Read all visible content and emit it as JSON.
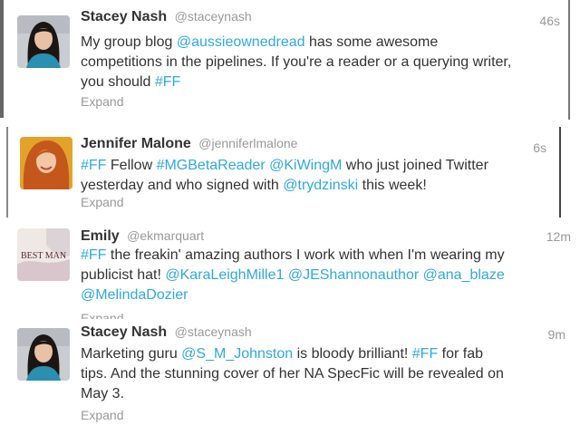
{
  "tweets": [
    {
      "name": "Stacey Nash",
      "handle": "@staceynash",
      "time": "46s",
      "avatar_icon": "woman-dark-hair-avatar-icon",
      "body": [
        [
          {
            "t": "My group blog "
          },
          {
            "t": "@aussieownedread",
            "link": true
          },
          {
            "t": " has some awesome"
          }
        ],
        [
          {
            "t": "competitions in the pipelines. If you're a reader or a querying writer,"
          }
        ],
        [
          {
            "t": "you should "
          },
          {
            "t": "#FF",
            "link": true
          }
        ]
      ],
      "expand": "Expand"
    },
    {
      "name": "Jennifer Malone",
      "handle": "@jenniferlmalone",
      "time": "6s",
      "avatar_icon": "woman-red-hair-avatar-icon",
      "body": [
        [
          {
            "t": "#FF",
            "link": true
          },
          {
            "t": " Fellow "
          },
          {
            "t": "#MGBetaReader",
            "link": true
          },
          {
            "t": " "
          },
          {
            "t": "@KiWingM",
            "link": true
          },
          {
            "t": " who just joined Twitter"
          }
        ],
        [
          {
            "t": "yesterday and who signed with "
          },
          {
            "t": "@trydzinski",
            "link": true
          },
          {
            "t": " this week!"
          }
        ]
      ],
      "expand": "Expand"
    },
    {
      "name": "Emily",
      "handle": "@ekmarquart",
      "time": "12m",
      "avatar_icon": "book-cover-avatar-icon",
      "avatar_text": "BEST MAN",
      "body": [
        [
          {
            "t": "#FF",
            "link": true
          },
          {
            "t": " the freakin' amazing authors I work with when I'm wearing my"
          }
        ],
        [
          {
            "t": "publicist hat! "
          },
          {
            "t": "@KaraLeighMille1",
            "link": true
          },
          {
            "t": " "
          },
          {
            "t": "@JEShannonauthor",
            "link": true
          },
          {
            "t": " "
          },
          {
            "t": "@ana_blaze",
            "link": true
          }
        ],
        [
          {
            "t": "@MelindaDozier",
            "link": true
          }
        ]
      ],
      "expand": "Expand"
    },
    {
      "name": "Stacey Nash",
      "handle": "@staceynash",
      "time": "9m",
      "avatar_icon": "woman-dark-hair-avatar-icon",
      "body": [
        [
          {
            "t": "Marketing guru "
          },
          {
            "t": "@S_M_Johnston",
            "link": true
          },
          {
            "t": " is bloody brilliant! "
          },
          {
            "t": "#FF",
            "link": true
          },
          {
            "t": " for fab"
          }
        ],
        [
          {
            "t": "tips. And the stunning cover of her NA SpecFic will be revealed on"
          }
        ],
        [
          {
            "t": "May 3."
          }
        ]
      ],
      "expand": "Expand"
    }
  ]
}
